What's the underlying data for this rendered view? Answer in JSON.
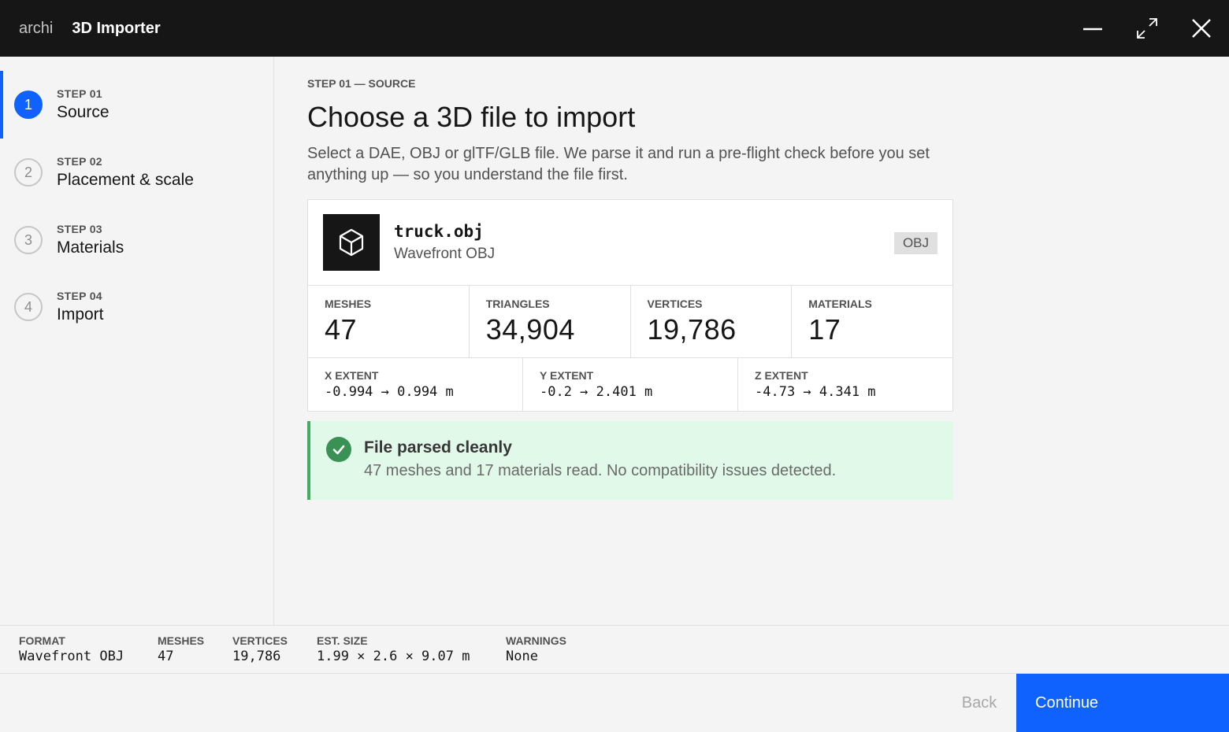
{
  "titlebar": {
    "brand": "archi",
    "title": "3D Importer"
  },
  "steps": [
    {
      "number": "1",
      "kicker": "STEP 01",
      "label": "Source",
      "active": true
    },
    {
      "number": "2",
      "kicker": "STEP 02",
      "label": "Placement & scale",
      "active": false
    },
    {
      "number": "3",
      "kicker": "STEP 03",
      "label": "Materials",
      "active": false
    },
    {
      "number": "4",
      "kicker": "STEP 04",
      "label": "Import",
      "active": false
    }
  ],
  "main": {
    "kicker": "STEP 01 — SOURCE",
    "headline": "Choose a 3D file to import",
    "lead": "Select a DAE, OBJ or glTF/GLB file. We parse it and run a pre-flight check before you set anything up — so you understand the file first."
  },
  "file": {
    "icon": "cube-icon",
    "name": "truck.obj",
    "type": "Wavefront OBJ",
    "tag": "OBJ"
  },
  "stats": [
    {
      "label": "MESHES",
      "value": "47"
    },
    {
      "label": "TRIANGLES",
      "value": "34,904"
    },
    {
      "label": "VERTICES",
      "value": "19,786"
    },
    {
      "label": "MATERIALS",
      "value": "17"
    }
  ],
  "extents": [
    {
      "label": "X EXTENT",
      "value": "-0.994 → 0.994 m"
    },
    {
      "label": "Y EXTENT",
      "value": "-0.2 → 2.401 m"
    },
    {
      "label": "Z EXTENT",
      "value": "-4.73 → 4.341 m"
    }
  ],
  "notice": {
    "icon": "check-circle-icon",
    "title": "File parsed cleanly",
    "body": "47 meshes and 17 materials read. No compatibility issues detected."
  },
  "summary": {
    "format": {
      "label": "FORMAT",
      "value": "Wavefront OBJ"
    },
    "meshes": {
      "label": "MESHES",
      "value": "47"
    },
    "vertices": {
      "label": "VERTICES",
      "value": "19,786"
    },
    "size": {
      "label": "EST. SIZE",
      "value": "1.99 × 2.6 × 9.07 m"
    },
    "warnings": {
      "label": "WARNINGS",
      "value": "None"
    }
  },
  "footer": {
    "back_label": "Back",
    "continue_label": "Continue"
  },
  "colors": {
    "accent": "#0f62fe",
    "success": "#24a148",
    "titlebar": "#161616"
  }
}
